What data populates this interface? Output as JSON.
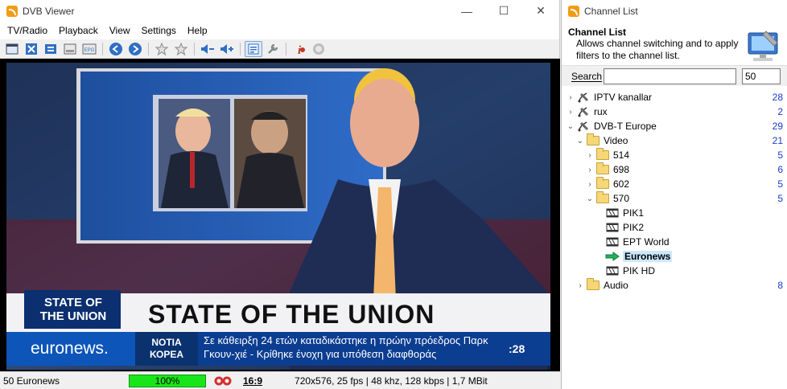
{
  "main_window": {
    "title": "DVB Viewer",
    "controls": {
      "minimize": "—",
      "maximize": "☐",
      "close": "✕"
    },
    "menu": [
      "TV/Radio",
      "Playback",
      "View",
      "Settings",
      "Help"
    ]
  },
  "toolbar": {
    "buttons": [
      "display-mode",
      "fullscreen",
      "teletext",
      "osd",
      "epg",
      "back",
      "forward",
      "favorite",
      "favorite-list",
      "volume-down",
      "volume-up",
      "channel-list",
      "tools",
      "info",
      "record"
    ]
  },
  "video": {
    "banner_title": "STATE OF THE UNION",
    "logo_line1": "STATE OF",
    "logo_line2": "THE UNION",
    "channel_logo": "euronews.",
    "ticker_label_line1": "ΝΟΤΙΑ",
    "ticker_label_line2": "ΚΟΡΕΑ",
    "ticker_text_line1": "Σε κάθειρξη 24 ετών καταδικάστηκε η πρώην πρόεδρος Παρκ",
    "ticker_text_line2": "Γκουν-χιέ - Κρίθηκε ένοχη για υπόθεση διαφθοράς",
    "clock": ":28"
  },
  "statusbar": {
    "channel": "50 Euronews",
    "progress": "100%",
    "progress_value": 100,
    "aspect": "16:9",
    "info": "720x576, 25 fps | 48 khz, 128 kbps | 1,7 MBit"
  },
  "side_window": {
    "title": "Channel List",
    "header_title": "Channel List",
    "header_desc": "Allows channel switching and to apply filters to the channel list.",
    "search_label": "Search",
    "search_value": "",
    "number_value": "50",
    "tree": [
      {
        "label": "IPTV kanallar",
        "count": "28",
        "level": 0,
        "type": "sat",
        "expander": "›"
      },
      {
        "label": "rux",
        "count": "2",
        "level": 0,
        "type": "sat",
        "expander": "›"
      },
      {
        "label": "DVB-T Europe",
        "count": "29",
        "level": 0,
        "type": "sat",
        "expander": "⌄"
      },
      {
        "label": "Video",
        "count": "21",
        "level": 1,
        "type": "folder",
        "expander": "⌄"
      },
      {
        "label": "514",
        "count": "5",
        "level": 2,
        "type": "folder",
        "expander": "›"
      },
      {
        "label": "698",
        "count": "6",
        "level": 2,
        "type": "folder",
        "expander": "›"
      },
      {
        "label": "602",
        "count": "5",
        "level": 2,
        "type": "folder",
        "expander": "›"
      },
      {
        "label": "570",
        "count": "5",
        "level": 2,
        "type": "folder",
        "expander": "⌄"
      },
      {
        "label": "PIK1",
        "count": "",
        "level": 3,
        "type": "tv",
        "expander": ""
      },
      {
        "label": "PIK2",
        "count": "",
        "level": 3,
        "type": "tv",
        "expander": ""
      },
      {
        "label": "EPT World",
        "count": "",
        "level": 3,
        "type": "tv",
        "expander": ""
      },
      {
        "label": "Euronews",
        "count": "",
        "level": 3,
        "type": "playing",
        "expander": "",
        "selected": true
      },
      {
        "label": "PIK HD",
        "count": "",
        "level": 3,
        "type": "tv",
        "expander": ""
      },
      {
        "label": "Audio",
        "count": "8",
        "level": 1,
        "type": "folder",
        "expander": "›"
      }
    ]
  },
  "colors": {
    "accent_blue": "#1a3cc8",
    "progress_green": "#19e619",
    "selection": "#cce8ff",
    "app_icon": "#f39c12"
  }
}
